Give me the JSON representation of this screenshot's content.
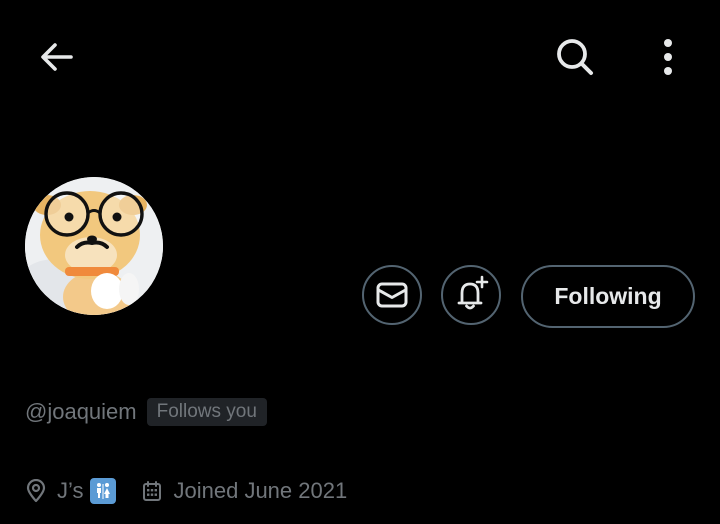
{
  "header": {
    "back_icon": "arrow-left-icon",
    "search_icon": "search-icon",
    "more_icon": "more-vertical-icon"
  },
  "profile": {
    "handle": "@joaquiem",
    "follows_you": "Follows you",
    "location": "J’s",
    "location_emoji": "restroom-sign-emoji",
    "joined": "Joined June 2021"
  },
  "actions": {
    "message_icon": "mail-icon",
    "notify_icon": "bell-plus-icon",
    "following_label": "Following"
  },
  "colors": {
    "background": "#000000",
    "primary_text": "#e7e9ea",
    "secondary_text": "#71767b",
    "border": "#536471",
    "badge_bg": "#202327"
  }
}
